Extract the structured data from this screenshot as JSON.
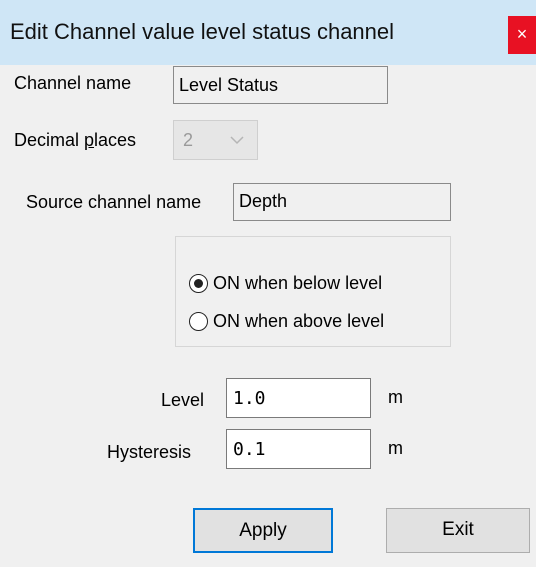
{
  "window": {
    "title": "Edit Channel value level status channel",
    "close_glyph": "×"
  },
  "form": {
    "channel_name_label": "Channel name",
    "channel_name_value": "Level Status",
    "decimal_places_label_prefix": "Decimal ",
    "decimal_places_label_access": "p",
    "decimal_places_label_suffix": "laces",
    "decimal_places_value": "2",
    "source_channel_label": "Source channel name",
    "source_channel_value": "Depth",
    "radio_below_label": "ON when below level",
    "radio_above_label": "ON when above level",
    "radio_selected": "below",
    "level_label": "Level",
    "level_value": "1.0",
    "level_unit": "m",
    "hysteresis_label": "Hysteresis",
    "hysteresis_value": "0.1",
    "hysteresis_unit": "m"
  },
  "buttons": {
    "apply": "Apply",
    "exit": "Exit"
  },
  "icons": {
    "close": "close-icon",
    "dropdown": "chevron-down-icon"
  },
  "colors": {
    "titlebar": "#cfe6f6",
    "close": "#e81123",
    "default_button_border": "#0078d7"
  }
}
